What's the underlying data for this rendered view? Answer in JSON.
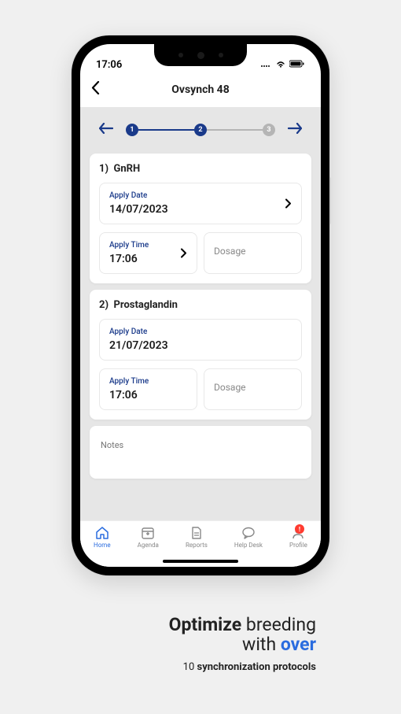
{
  "statusBar": {
    "time": "17:06"
  },
  "header": {
    "title": "Ovsynch 48"
  },
  "stepper": {
    "steps": [
      "1",
      "2",
      "3"
    ],
    "activeUntil": 2
  },
  "steps": [
    {
      "num": "1)",
      "name": "GnRH",
      "applyDateLabel": "Apply Date",
      "applyDate": "14/07/2023",
      "applyTimeLabel": "Apply Time",
      "applyTime": "17:06",
      "dosageLabel": "Dosage"
    },
    {
      "num": "2)",
      "name": "Prostaglandin",
      "applyDateLabel": "Apply Date",
      "applyDate": "21/07/2023",
      "applyTimeLabel": "Apply Time",
      "applyTime": "17:06",
      "dosageLabel": "Dosage"
    }
  ],
  "notesLabel": "Notes",
  "nav": {
    "items": [
      {
        "label": "Home"
      },
      {
        "label": "Agenda"
      },
      {
        "label": "Reports"
      },
      {
        "label": "Help Desk"
      },
      {
        "label": "Profile",
        "badge": "!"
      }
    ]
  },
  "marketing": {
    "word1bold": "Optimize",
    "word1rest": " breeding",
    "line2a": "with ",
    "line2b": "over",
    "line3a": "10 ",
    "line3b": "synchronization protocols"
  }
}
